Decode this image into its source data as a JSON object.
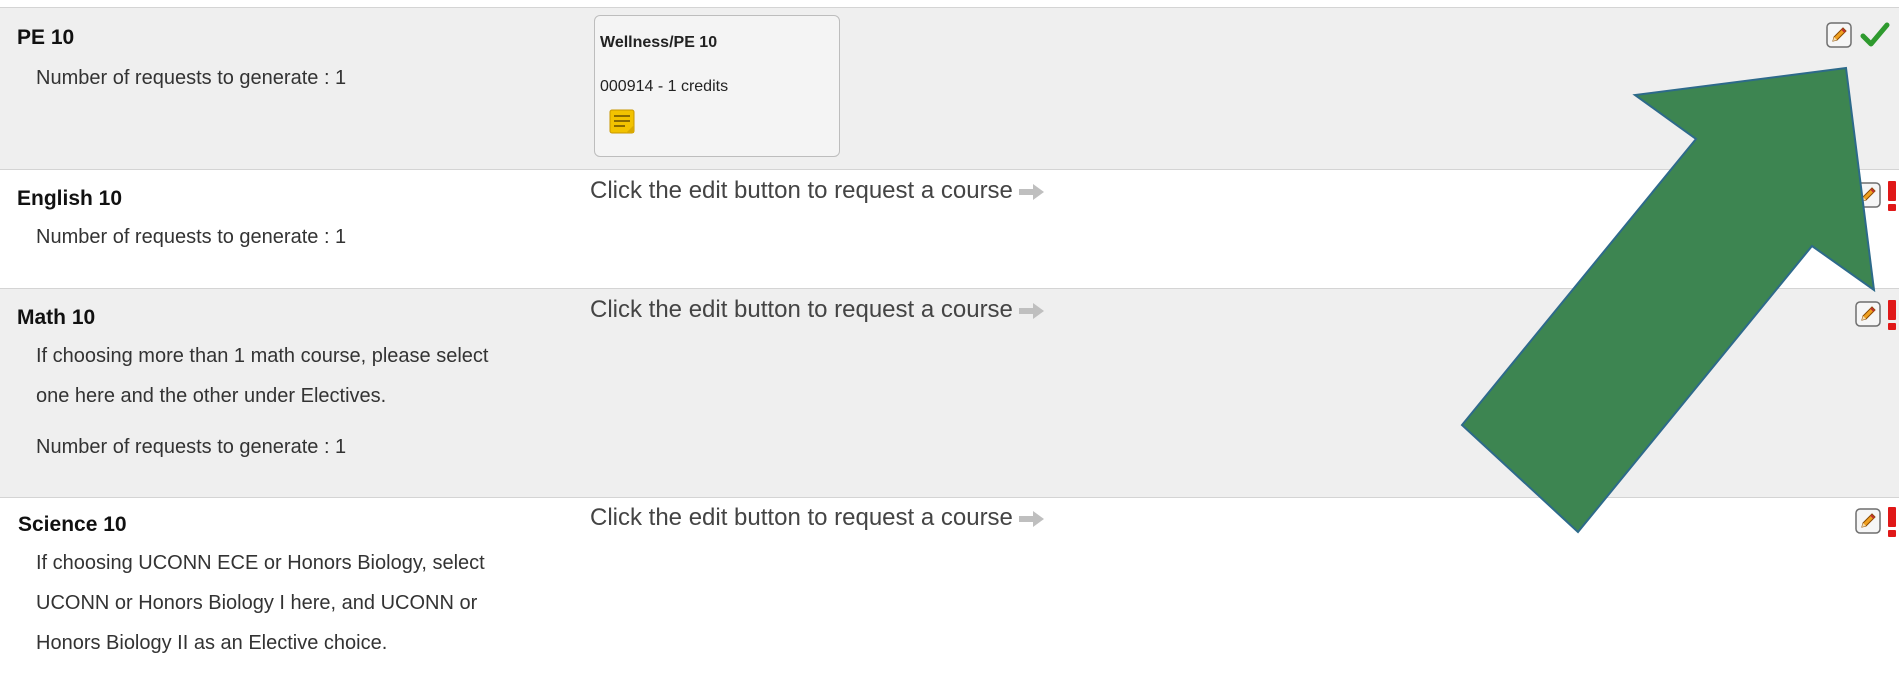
{
  "rows": [
    {
      "title": "PE 10",
      "requests_text": "Number of requests to generate : 1",
      "request": {
        "name": "Wellness/PE 10",
        "detail": "000914 - 1 credits"
      },
      "status": "complete"
    },
    {
      "title": "English 10",
      "prompt": "Click the edit button to request a course",
      "requests_text": "Number of requests to generate : 1",
      "status": "missing"
    },
    {
      "title": "Math 10",
      "prompt": "Click the edit button to request a course",
      "description": [
        "If choosing more than 1 math course, please select",
        "one here and the other under Electives."
      ],
      "requests_text": "Number of requests to generate : 1",
      "status": "missing"
    },
    {
      "title": "Science 10",
      "prompt": "Click the edit button to request a course",
      "description": [
        "If choosing UCONN ECE or Honors Biology, select",
        "UCONN or Honors Biology I here, and UCONN or",
        "Honors Biology II as an Elective choice."
      ],
      "status": "missing"
    }
  ],
  "icons": {
    "edit": "pencil-edit-icon",
    "complete": "green-checkmark-icon",
    "missing": "red-exclamation-icon",
    "note": "sticky-note-icon",
    "prompt_arrow": "gray-right-arrow-icon",
    "overlay": "green-pointer-arrow"
  },
  "colors": {
    "row_shaded": "#efefef",
    "overlay_arrow": "#3d8551",
    "check": "#2e9a2e",
    "exclamation": "#e01818"
  }
}
